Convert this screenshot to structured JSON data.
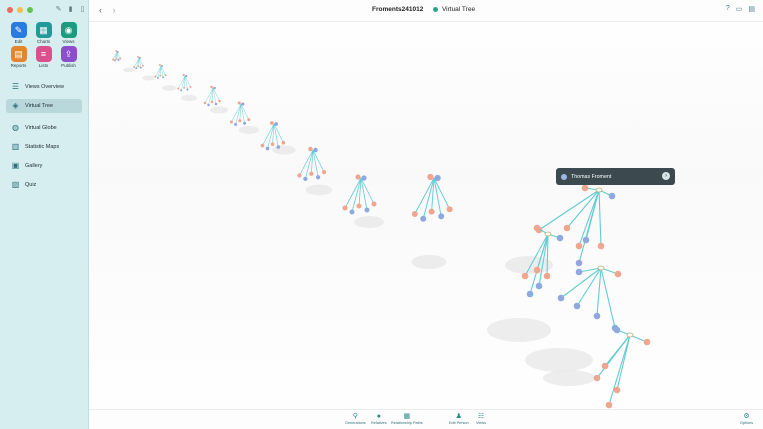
{
  "window": {
    "title": "Froments241012",
    "view_name": "Virtual Tree"
  },
  "colors": {
    "accent": "#2aa58c",
    "sidebar_bg": "#d6eef0",
    "male": "#8ea9e0",
    "female": "#f0a58e",
    "line": "#63ccd3"
  },
  "apps": [
    {
      "label": "Edit",
      "color": "#2a7be0",
      "icon": "pencil-icon",
      "glyph": "✎"
    },
    {
      "label": "Charts",
      "color": "#229a9a",
      "icon": "charts-icon",
      "glyph": "▦"
    },
    {
      "label": "Views",
      "color": "#1c9b80",
      "icon": "eye-icon",
      "glyph": "◉"
    },
    {
      "label": "Reports",
      "color": "#e3852d",
      "icon": "reports-icon",
      "glyph": "▤"
    },
    {
      "label": "Lists",
      "color": "#d9508c",
      "icon": "list-icon",
      "glyph": "≡"
    },
    {
      "label": "Publish",
      "color": "#8a4fc9",
      "icon": "publish-icon",
      "glyph": "⇪"
    }
  ],
  "nav": [
    {
      "label": "Views Overview",
      "icon": "overview-icon",
      "glyph": "☰"
    },
    {
      "label": "Virtual Tree",
      "icon": "virtual-tree-icon",
      "glyph": "◈"
    },
    {
      "label": "Virtual Globe",
      "icon": "globe-icon",
      "glyph": "◍"
    },
    {
      "label": "Statistic Maps",
      "icon": "map-icon",
      "glyph": "▥"
    },
    {
      "label": "Gallery",
      "icon": "gallery-icon",
      "glyph": "▣"
    },
    {
      "label": "Quiz",
      "icon": "quiz-icon",
      "glyph": "▧"
    }
  ],
  "selected_person": "Thomas Froment",
  "bottom": {
    "generations": "Generations",
    "relatives": "Relatives",
    "relationship_paths": "Relationship Paths",
    "edit_person": "Edit Person",
    "views": "Views",
    "options": "Options"
  }
}
